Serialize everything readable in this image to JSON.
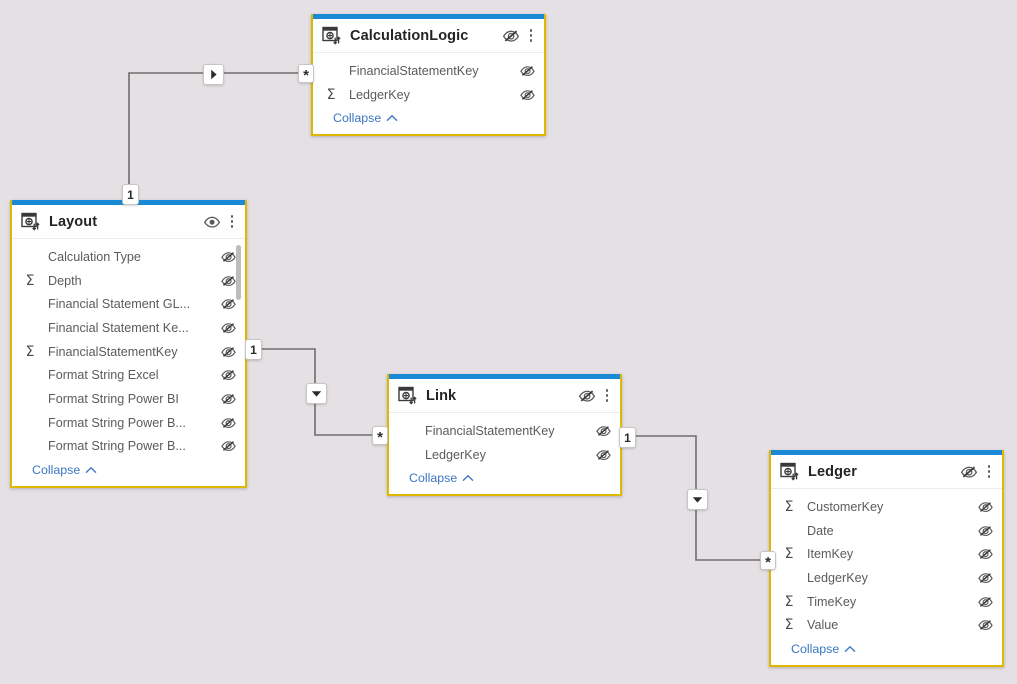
{
  "view": {
    "name": "model-diagram-view",
    "background_color": "#e4e0e3",
    "card_border_color": "#e0b800",
    "card_accent_color": "#1b8ad6",
    "link_color": "#3a77c2",
    "collapse_label": "Collapse"
  },
  "tables": [
    {
      "id": "calculationlogic",
      "name": "CalculationLogic",
      "header_eye_icon": "eye-hidden-icon",
      "menu_icon": "kebab-menu-icon",
      "table_icon": "table-icon",
      "has_scrollbar": false,
      "fields": [
        {
          "name": "FinancialStatementKey",
          "aggregate": false,
          "eye_icon": "eye-hidden-icon"
        },
        {
          "name": "LedgerKey",
          "aggregate": true,
          "eye_icon": "eye-hidden-icon"
        }
      ]
    },
    {
      "id": "layout",
      "name": "Layout",
      "header_eye_icon": "eye-visible-icon",
      "menu_icon": "kebab-menu-icon",
      "table_icon": "table-icon",
      "has_scrollbar": true,
      "fields": [
        {
          "name": "Calculation Type",
          "aggregate": false,
          "eye_icon": "eye-hidden-icon"
        },
        {
          "name": "Depth",
          "aggregate": true,
          "eye_icon": "eye-hidden-icon"
        },
        {
          "name": "Financial Statement GL...",
          "aggregate": false,
          "eye_icon": "eye-hidden-icon"
        },
        {
          "name": "Financial Statement Ke...",
          "aggregate": false,
          "eye_icon": "eye-hidden-icon"
        },
        {
          "name": "FinancialStatementKey",
          "aggregate": true,
          "eye_icon": "eye-hidden-icon"
        },
        {
          "name": "Format String Excel",
          "aggregate": false,
          "eye_icon": "eye-hidden-icon"
        },
        {
          "name": "Format String Power BI",
          "aggregate": false,
          "eye_icon": "eye-hidden-icon"
        },
        {
          "name": "Format String Power B...",
          "aggregate": false,
          "eye_icon": "eye-hidden-icon"
        },
        {
          "name": "Format String Power B...",
          "aggregate": false,
          "eye_icon": "eye-hidden-icon"
        }
      ]
    },
    {
      "id": "link",
      "name": "Link",
      "header_eye_icon": "eye-hidden-icon",
      "menu_icon": "kebab-menu-icon",
      "table_icon": "table-icon",
      "has_scrollbar": false,
      "fields": [
        {
          "name": "FinancialStatementKey",
          "aggregate": false,
          "eye_icon": "eye-hidden-icon"
        },
        {
          "name": "LedgerKey",
          "aggregate": false,
          "eye_icon": "eye-hidden-icon"
        }
      ]
    },
    {
      "id": "ledger",
      "name": "Ledger",
      "header_eye_icon": "eye-hidden-icon",
      "menu_icon": "kebab-menu-icon",
      "table_icon": "table-icon",
      "has_scrollbar": false,
      "fields": [
        {
          "name": "CustomerKey",
          "aggregate": true,
          "eye_icon": "eye-hidden-icon"
        },
        {
          "name": "Date",
          "aggregate": false,
          "eye_icon": "eye-hidden-icon"
        },
        {
          "name": "ItemKey",
          "aggregate": true,
          "eye_icon": "eye-hidden-icon"
        },
        {
          "name": "LedgerKey",
          "aggregate": false,
          "eye_icon": "eye-hidden-icon"
        },
        {
          "name": "TimeKey",
          "aggregate": true,
          "eye_icon": "eye-hidden-icon"
        },
        {
          "name": "Value",
          "aggregate": true,
          "eye_icon": "eye-hidden-icon"
        }
      ]
    }
  ],
  "relationships": [
    {
      "id": "layout-to-calculationlogic",
      "from_table": "Layout",
      "to_table": "CalculationLogic",
      "from_cardinality": "1",
      "to_cardinality": "*",
      "cross_filter_icon": "arrow-right-icon"
    },
    {
      "id": "layout-to-link",
      "from_table": "Layout",
      "to_table": "Link",
      "from_cardinality": "1",
      "to_cardinality": "*",
      "cross_filter_icon": "arrow-down-icon"
    },
    {
      "id": "link-to-ledger",
      "from_table": "Link",
      "to_table": "Ledger",
      "from_cardinality": "1",
      "to_cardinality": "*",
      "cross_filter_icon": "arrow-down-icon"
    }
  ]
}
